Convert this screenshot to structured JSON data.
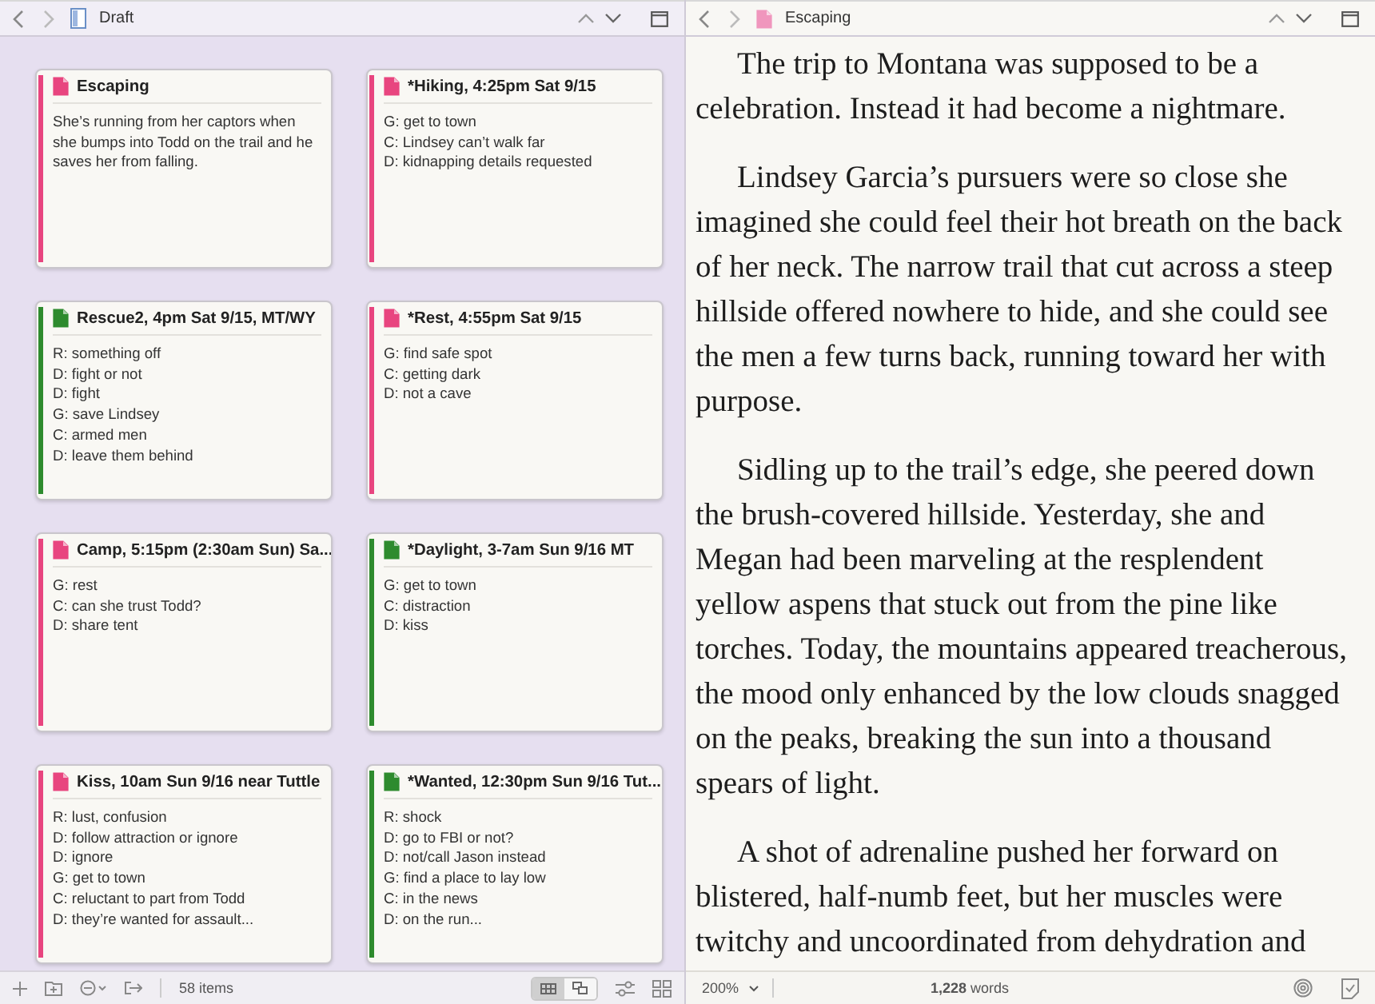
{
  "binder_pane": {
    "header": {
      "title": "Draft"
    },
    "cards": [
      {
        "title": "Escaping",
        "color": "#e8457f",
        "lines": [
          "She’s running from her captors when she bumps into Todd on the trail and he saves her from falling."
        ]
      },
      {
        "title": "*Hiking, 4:25pm Sat 9/15",
        "color": "#e8457f",
        "lines": [
          "G: get to town",
          "C: Lindsey can’t walk far",
          "D: kidnapping details requested"
        ]
      },
      {
        "title": "Rescue2, 4pm Sat 9/15, MT/WY",
        "color": "#2e8b2e",
        "lines": [
          "R: something off",
          "D: fight or not",
          "D: fight",
          "G: save Lindsey",
          "C: armed men",
          "D: leave them behind"
        ]
      },
      {
        "title": "*Rest, 4:55pm Sat 9/15",
        "color": "#e8457f",
        "lines": [
          "G: find safe spot",
          "C: getting dark",
          "D: not a cave"
        ]
      },
      {
        "title": "Camp, 5:15pm (2:30am Sun) Sa...",
        "color": "#e8457f",
        "lines": [
          "G: rest",
          "C: can she trust Todd?",
          "D: share tent"
        ]
      },
      {
        "title": "*Daylight, 3-7am Sun 9/16 MT",
        "color": "#2e8b2e",
        "lines": [
          "G: get to town",
          "C: distraction",
          "D: kiss"
        ]
      },
      {
        "title": "Kiss, 10am Sun 9/16 near Tuttle",
        "color": "#e8457f",
        "lines": [
          "R: lust, confusion",
          "D: follow attraction or ignore",
          "D: ignore",
          "G: get to town",
          "C: reluctant to part from Todd",
          "D: they’re wanted for assault..."
        ]
      },
      {
        "title": "*Wanted, 12:30pm Sun 9/16 Tut...",
        "color": "#2e8b2e",
        "lines": [
          "R: shock",
          "D: go to FBI or not?",
          "D: not/call Jason instead",
          "G: find a place to lay low",
          "C: in the news",
          "D: on the run..."
        ]
      }
    ],
    "footer": {
      "item_count": "58 items",
      "view_modes": [
        {
          "selected": true
        },
        {
          "selected": false
        }
      ]
    }
  },
  "editor_pane": {
    "header": {
      "title": "Escaping"
    },
    "paragraphs": [
      "The trip to Montana was supposed to be a celebration. Instead it had become a nightmare.",
      "Lindsey Garcia’s pursuers were so close she imagined she could feel their hot breath on the back of her neck. The narrow trail that cut across a steep hillside offered nowhere to hide, and she could see the men a few turns back, running toward her with purpose.",
      "Sidling up to the trail’s edge, she peered down the brush-covered hillside. Yesterday, she and Megan had been marveling at the resplendent yellow aspens that stuck out from the pine like torches. Today, the mountains appeared treacherous, the mood only enhanced by the low clouds snagged on the peaks, breaking the sun into a thousand spears of light.",
      "A shot of adrenaline pushed her forward on blistered, half-numb feet, but her muscles were twitchy and uncoordinated from dehydration and"
    ],
    "footer": {
      "zoom": "200%",
      "word_count": "**1,228** words"
    }
  }
}
